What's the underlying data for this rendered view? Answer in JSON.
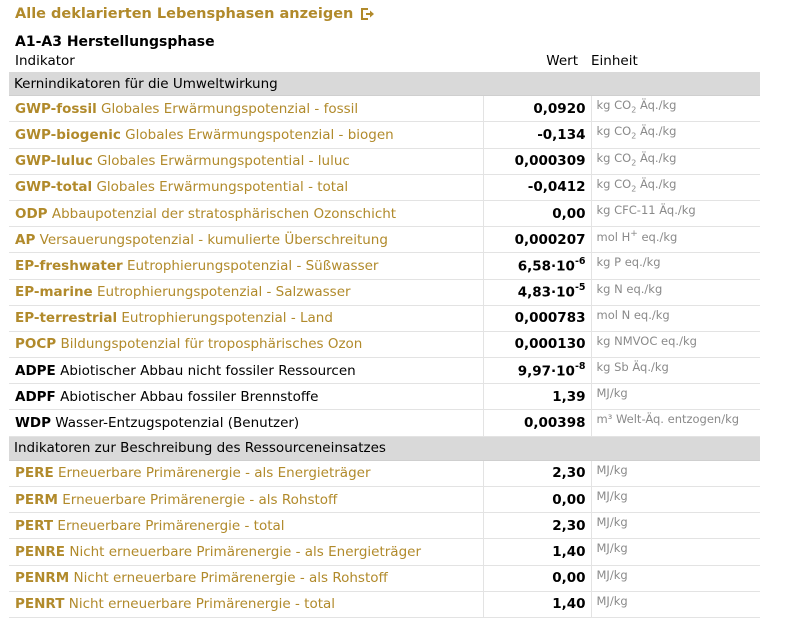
{
  "header": {
    "show_all_link": "Alle deklarierten Lebensphasen anzeigen",
    "phase_title": "A1-A3 Herstellungsphase"
  },
  "columns": {
    "indicator": "Indikator",
    "value": "Wert",
    "unit": "Einheit"
  },
  "sections": [
    {
      "title": "Kernindikatoren für die Umweltwirkung",
      "rows": [
        {
          "abbr": "GWP-fossil",
          "label": "Globales Erwärmungspotenzial - fossil",
          "color": "#b18a2b",
          "value": "0,0920",
          "unit_pre": "kg CO",
          "unit_sub": "2",
          "unit_post": " Äq./kg"
        },
        {
          "abbr": "GWP-biogenic",
          "label": "Globales Erwärmungspotenzial - biogen",
          "color": "#b18a2b",
          "value": "-0,134",
          "unit_pre": "kg CO",
          "unit_sub": "2",
          "unit_post": " Äq./kg"
        },
        {
          "abbr": "GWP-luluc",
          "label": "Globales Erwärmungspotential - luluc",
          "color": "#b18a2b",
          "value": "0,000309",
          "unit_pre": "kg CO",
          "unit_sub": "2",
          "unit_post": " Äq./kg"
        },
        {
          "abbr": "GWP-total",
          "label": "Globales Erwärmungspotential - total",
          "color": "#b18a2b",
          "value": "-0,0412",
          "unit_pre": "kg CO",
          "unit_sub": "2",
          "unit_post": " Äq./kg"
        },
        {
          "abbr": "ODP",
          "label": "Abbaupotenzial der stratosphärischen Ozonschicht",
          "color": "#b18a2b",
          "value": "0,00",
          "unit_pre": "kg CFC-11 Äq./kg"
        },
        {
          "abbr": "AP",
          "label": "Versauerungspotenzial - kumulierte Überschreitung",
          "color": "#b18a2b",
          "value": "0,000207",
          "unit_pre": "mol H",
          "unit_sup": "+",
          "unit_post": " eq./kg"
        },
        {
          "abbr": "EP-freshwater",
          "label": "Eutrophierungspotenzial - Süßwasser",
          "color": "#b18a2b",
          "value": "6,58·10",
          "value_exp": "-6",
          "unit_pre": "kg P eq./kg"
        },
        {
          "abbr": "EP-marine",
          "label": "Eutrophierungspotenzial - Salzwasser",
          "color": "#b18a2b",
          "value": "4,83·10",
          "value_exp": "-5",
          "unit_pre": "kg N eq./kg"
        },
        {
          "abbr": "EP-terrestrial",
          "label": "Eutrophierungspotenzial - Land",
          "color": "#b18a2b",
          "value": "0,000783",
          "unit_pre": "mol N eq./kg"
        },
        {
          "abbr": "POCP",
          "label": "Bildungspotenzial für troposphärisches Ozon",
          "color": "#b18a2b",
          "value": "0,000130",
          "unit_pre": "kg NMVOC eq./kg"
        },
        {
          "abbr": "ADPE",
          "label": "Abiotischer Abbau nicht fossiler Ressourcen",
          "color": "#000000",
          "value": "9,97·10",
          "value_exp": "-8",
          "unit_pre": "kg Sb Äq./kg"
        },
        {
          "abbr": "ADPF",
          "label": "Abiotischer Abbau fossiler Brennstoffe",
          "color": "#000000",
          "value": "1,39",
          "unit_pre": "MJ/kg"
        },
        {
          "abbr": "WDP",
          "label": "Wasser-Entzugspotenzial (Benutzer)",
          "color": "#000000",
          "value": "0,00398",
          "unit_pre": "m³ Welt-Äq. entzogen/kg"
        }
      ]
    },
    {
      "title": "Indikatoren zur Beschreibung des Ressourceneinsatzes",
      "rows": [
        {
          "abbr": "PERE",
          "label": "Erneuerbare Primärenergie - als Energieträger",
          "color": "#b18a2b",
          "value": "2,30",
          "unit_pre": "MJ/kg"
        },
        {
          "abbr": "PERM",
          "label": "Erneuerbare Primärenergie - als Rohstoff",
          "color": "#b18a2b",
          "value": "0,00",
          "unit_pre": "MJ/kg"
        },
        {
          "abbr": "PERT",
          "label": "Erneuerbare Primärenergie - total",
          "color": "#b18a2b",
          "value": "2,30",
          "unit_pre": "MJ/kg"
        },
        {
          "abbr": "PENRE",
          "label": "Nicht erneuerbare Primärenergie - als Energieträger",
          "color": "#b18a2b",
          "value": "1,40",
          "unit_pre": "MJ/kg"
        },
        {
          "abbr": "PENRM",
          "label": "Nicht erneuerbare Primärenergie - als Rohstoff",
          "color": "#b18a2b",
          "value": "0,00",
          "unit_pre": "MJ/kg"
        },
        {
          "abbr": "PENRT",
          "label": "Nicht erneuerbare Primärenergie - total",
          "color": "#b18a2b",
          "value": "1,40",
          "unit_pre": "MJ/kg"
        }
      ]
    }
  ]
}
